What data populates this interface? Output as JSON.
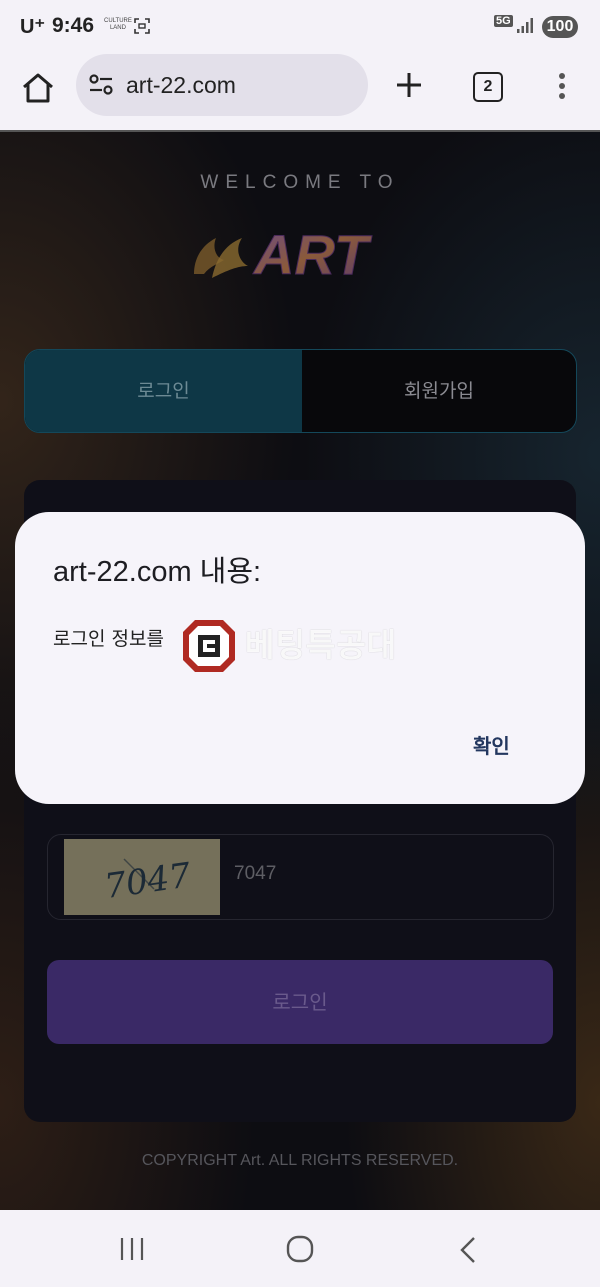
{
  "status_bar": {
    "carrier": "U⁺",
    "time": "9:46",
    "small_badge": "CULTURE LAND",
    "network": "5G",
    "battery": "100"
  },
  "browser": {
    "url": "art-22.com",
    "tab_count": "2",
    "icons": [
      "home-icon",
      "site-settings-icon",
      "plus-icon",
      "tabs-icon",
      "more-vert-icon"
    ]
  },
  "page": {
    "welcome": "WELCOME TO",
    "logo_text": "ART",
    "tabs": {
      "login": "로그인",
      "signup": "회원가입"
    },
    "captcha_code": "7047",
    "captcha_value": "7047",
    "login_button": "로그인",
    "copyright": "COPYRIGHT Art. ALL RIGHTS RESERVED.",
    "accent_color": "#3a2966",
    "tab_active_color": "#0e3746"
  },
  "dialog": {
    "title": "art-22.com 내용:",
    "message": "로그인 정보를",
    "watermark_text": "베팅특공대",
    "ok_button": "확인"
  },
  "nav": {
    "icons": [
      "recent-apps-icon",
      "home-circle-icon",
      "back-icon"
    ]
  }
}
